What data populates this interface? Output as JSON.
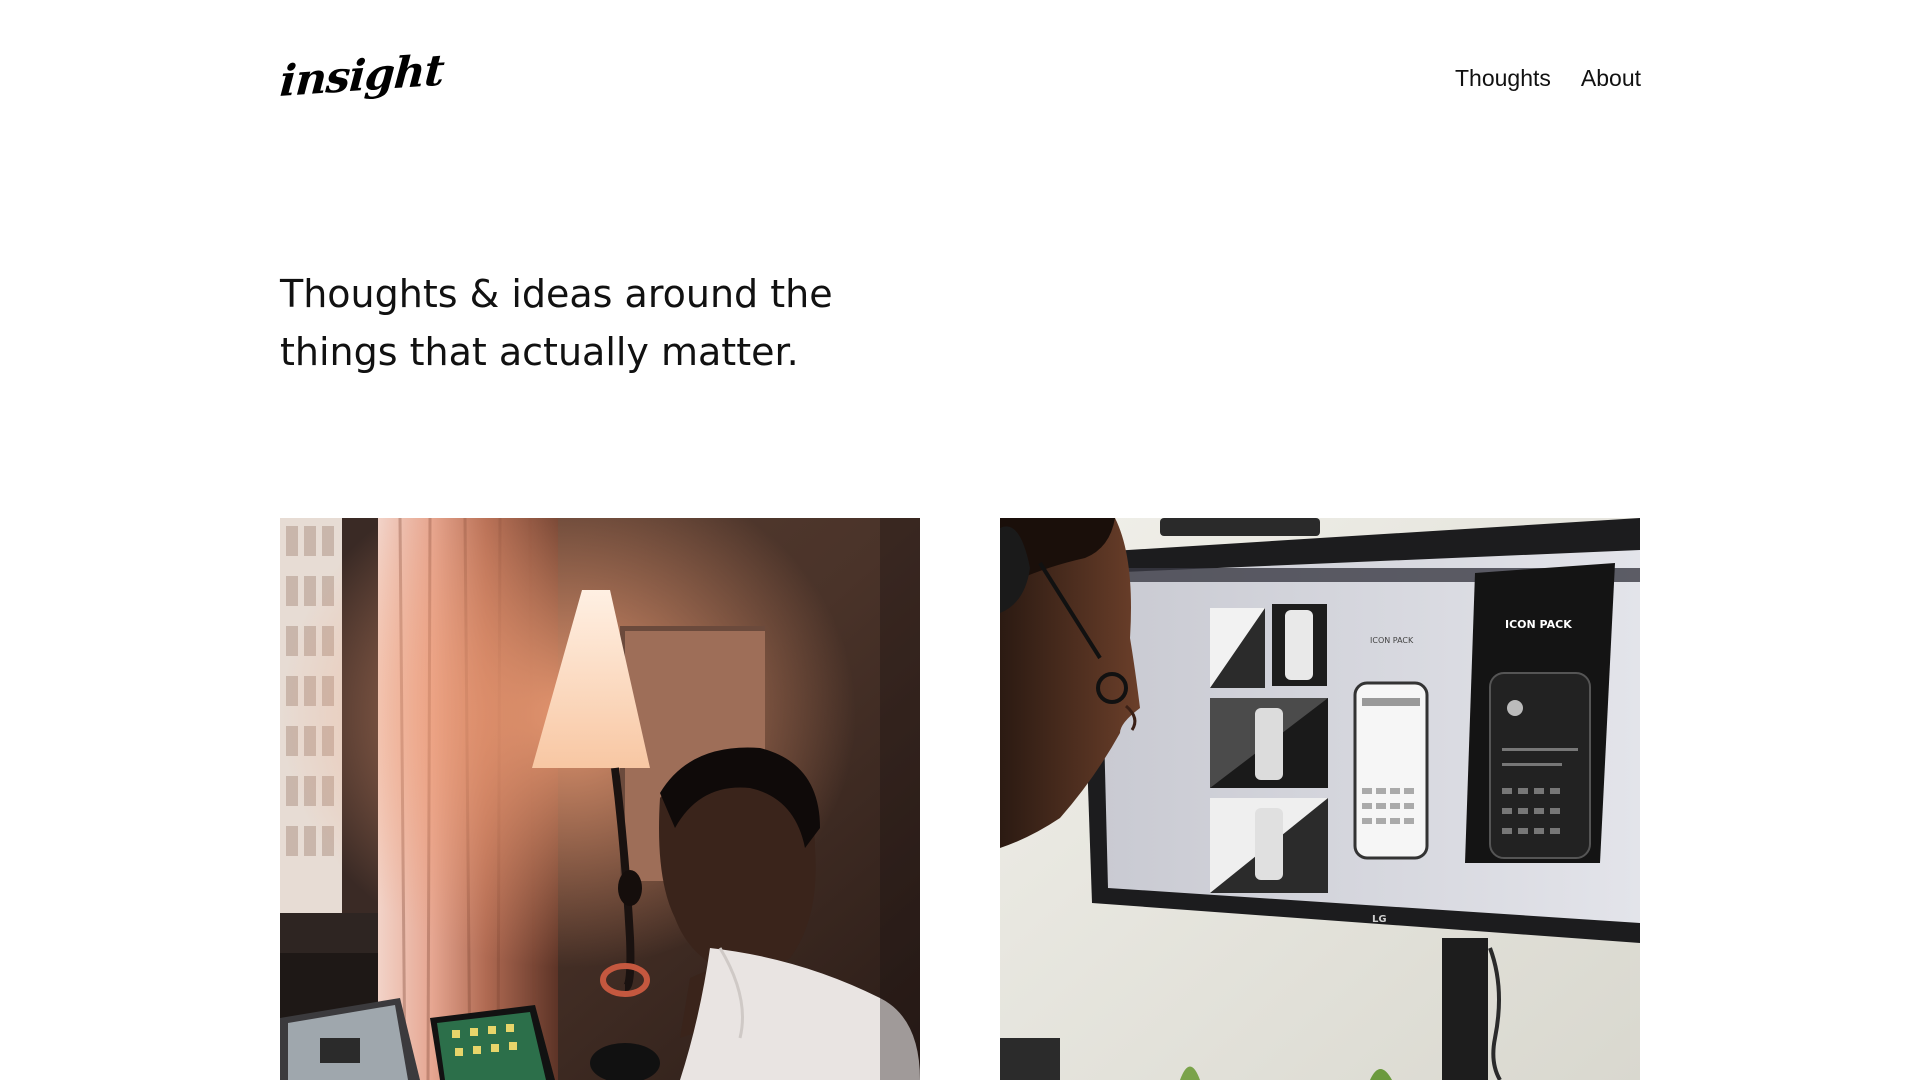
{
  "header": {
    "logo_text": "insight",
    "nav": [
      {
        "label": "Thoughts"
      },
      {
        "label": "About"
      }
    ]
  },
  "hero": {
    "line1": "Thoughts & ideas around the",
    "line2": "things that actually matter."
  },
  "posts": [
    {
      "image": "man-at-desk-lamp-photo"
    },
    {
      "image": "man-viewing-app-design-monitor-photo"
    }
  ],
  "monitor_screen": {
    "panel_title": "ICON PACK",
    "brand": "LG"
  }
}
